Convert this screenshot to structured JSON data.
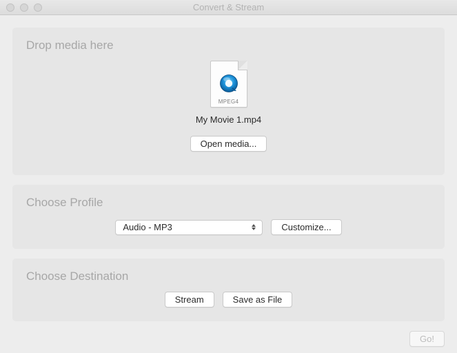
{
  "window": {
    "title": "Convert & Stream"
  },
  "drop": {
    "title": "Drop media here",
    "file_icon_label": "MPEG4",
    "filename": "My Movie 1.mp4",
    "open_media_label": "Open media..."
  },
  "profile": {
    "title": "Choose Profile",
    "selected": "Audio - MP3",
    "customize_label": "Customize..."
  },
  "destination": {
    "title": "Choose Destination",
    "stream_label": "Stream",
    "save_as_file_label": "Save as File"
  },
  "footer": {
    "go_label": "Go!"
  }
}
